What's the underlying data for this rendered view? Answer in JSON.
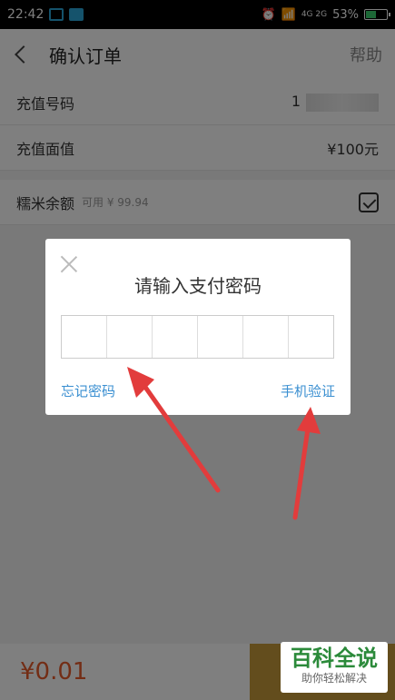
{
  "status": {
    "time": "22:42",
    "battery": "53%",
    "battery_level": 0.53,
    "network": "4G 2G"
  },
  "nav": {
    "title": "确认订单",
    "help": "帮助"
  },
  "rows": [
    {
      "label": "充值号码",
      "value": "1"
    },
    {
      "label": "充值面值",
      "value": "¥100元"
    }
  ],
  "balance": {
    "label": "糯米余额",
    "available": "可用 ¥ 99.94"
  },
  "bottom": {
    "total": "¥0.01"
  },
  "dialog": {
    "title": "请输入支付密码",
    "forgot": "忘记密码",
    "phone_verify": "手机验证"
  },
  "watermark": {
    "title": "百科全说",
    "subtitle": "助你轻松解决"
  },
  "colors": {
    "link": "#3a8fd1",
    "arrow": "#e23c3c",
    "accent": "#c79a3a"
  }
}
